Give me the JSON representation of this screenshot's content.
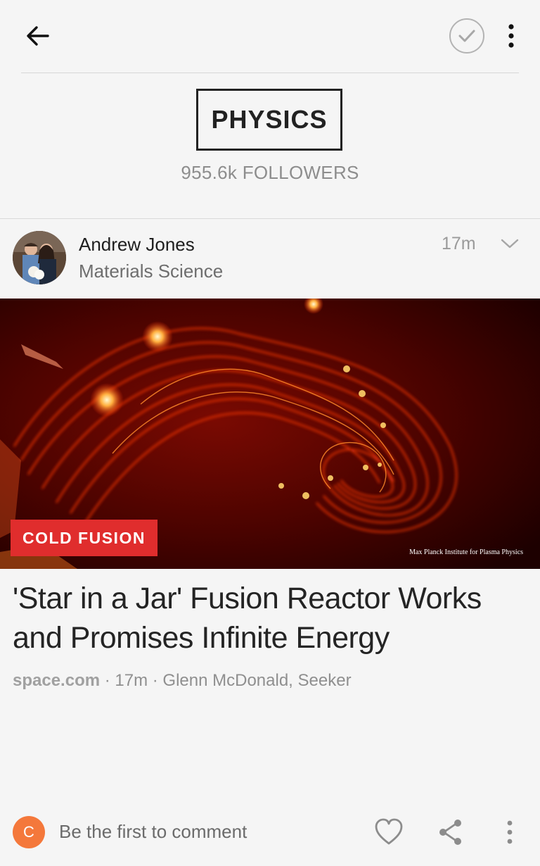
{
  "header": {
    "back_icon": "arrow-left-icon",
    "follow_icon": "check-circle-icon",
    "more_icon": "vertical-dots-icon"
  },
  "topic": {
    "title": "PHYSICS",
    "followers": "955.6k FOLLOWERS"
  },
  "post": {
    "author": "Andrew Jones",
    "author_topic": "Materials Science",
    "time": "17m",
    "tag": "COLD FUSION",
    "image_credit": "Max Planck Institute for Plasma Physics",
    "headline": "'Star in a Jar' Fusion Reactor Works and Promises Infinite Energy",
    "source": "space.com",
    "meta_rest": " · 17m · Glenn McDonald, Seeker"
  },
  "comments": {
    "avatar_letter": "C",
    "prompt": "Be the first to comment"
  },
  "colors": {
    "tag_bg": "#e02d2d",
    "avatar_bg": "#f4783b"
  }
}
